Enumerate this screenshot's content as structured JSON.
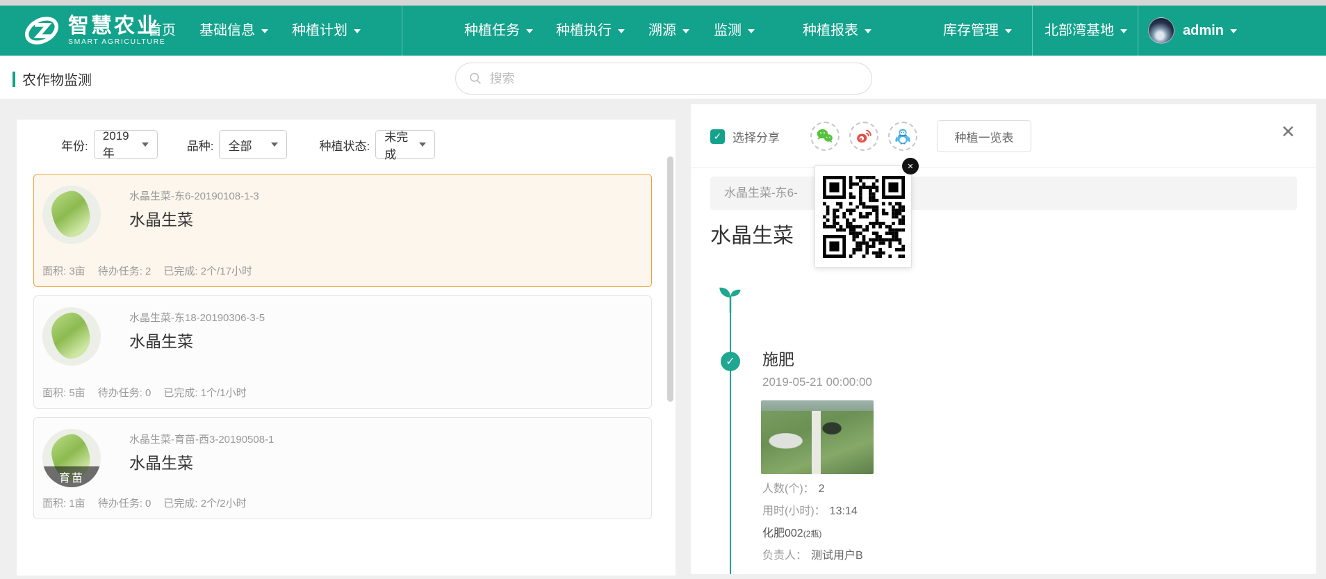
{
  "colors": {
    "accent": "#13A28C",
    "timeline": "#21A791",
    "sel-border": "#E9A23C",
    "sel-bg": "#FDF6EC",
    "wechat": "#57C23D",
    "weibo": "#E64D42",
    "qq": "#54B6E8"
  },
  "nav": {
    "brand": {
      "title": "智慧农业",
      "subtitle": "SMART AGRICULTURE"
    },
    "items": [
      {
        "label": "首页"
      },
      {
        "label": "基础信息"
      },
      {
        "label": "种植计划"
      },
      {
        "label": "种植任务"
      },
      {
        "label": "种植执行"
      },
      {
        "label": "溯源"
      },
      {
        "label": "监测"
      },
      {
        "label": "种植报表"
      },
      {
        "label": "库存管理"
      }
    ],
    "base": {
      "label": "北部湾基地"
    },
    "user": {
      "name": "admin"
    }
  },
  "header": {
    "page_title": "农作物监测",
    "search_placeholder": "搜索"
  },
  "filters": {
    "year_label": "年份:",
    "year_value": "2019年",
    "variety_label": "品种:",
    "variety_value": "全部",
    "status_label": "种植状态:",
    "status_value": "未完成"
  },
  "card_labels": {
    "area": "面积:",
    "todo": "待办任务:",
    "done": "已完成:"
  },
  "crops": [
    {
      "code": "水晶生菜-东6-20190108-1-3",
      "name": "水晶生菜",
      "area": "3亩",
      "todo": "2",
      "done": "2个/17小时",
      "badge": ""
    },
    {
      "code": "水晶生菜-东18-20190306-3-5",
      "name": "水晶生菜",
      "area": "5亩",
      "todo": "0",
      "done": "1个/1小时",
      "badge": ""
    },
    {
      "code": "水晶生菜-育苗-西3-20190508-1",
      "name": "水晶生菜",
      "area": "1亩",
      "todo": "0",
      "done": "2个/2小时",
      "badge": "育苗"
    }
  ],
  "detail": {
    "share_label": "选择分享",
    "overview_button": "种植一览表",
    "close_label": "✕",
    "qr_close_label": "✕",
    "banner": "水晶生菜-东6-",
    "title": "水晶生菜",
    "check_glyph": "✓",
    "event": {
      "title": "施肥",
      "datetime": "2019-05-21 00:00:00",
      "people_label": "人数(个)：",
      "people": "2",
      "duration_label": "用时(小时)：",
      "duration": "13:14",
      "material": "化肥002",
      "material_qty": "(2瓶)",
      "manager_label": "负责人：",
      "manager": "测试用户B"
    }
  }
}
